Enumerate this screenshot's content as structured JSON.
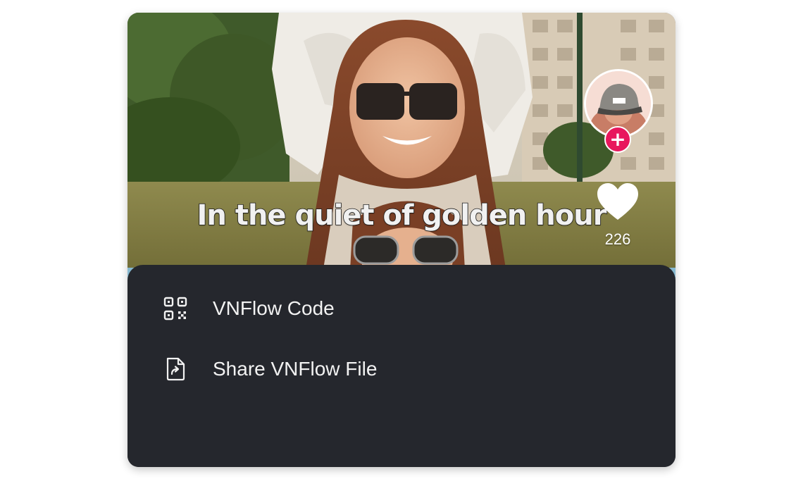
{
  "video": {
    "caption": "In the quiet of golden hour",
    "like_count": "226",
    "icons": {
      "like": "heart-icon",
      "follow": "plus-icon",
      "avatar": "creator-avatar"
    }
  },
  "share_sheet": {
    "items": [
      {
        "label": "VNFlow Code",
        "icon": "qr-code-icon"
      },
      {
        "label": "Share VNFlow File",
        "icon": "share-file-icon"
      }
    ]
  },
  "colors": {
    "sheet_background": "#25272d",
    "follow_accent": "#e8175d",
    "text_primary": "#f2f2f2"
  }
}
